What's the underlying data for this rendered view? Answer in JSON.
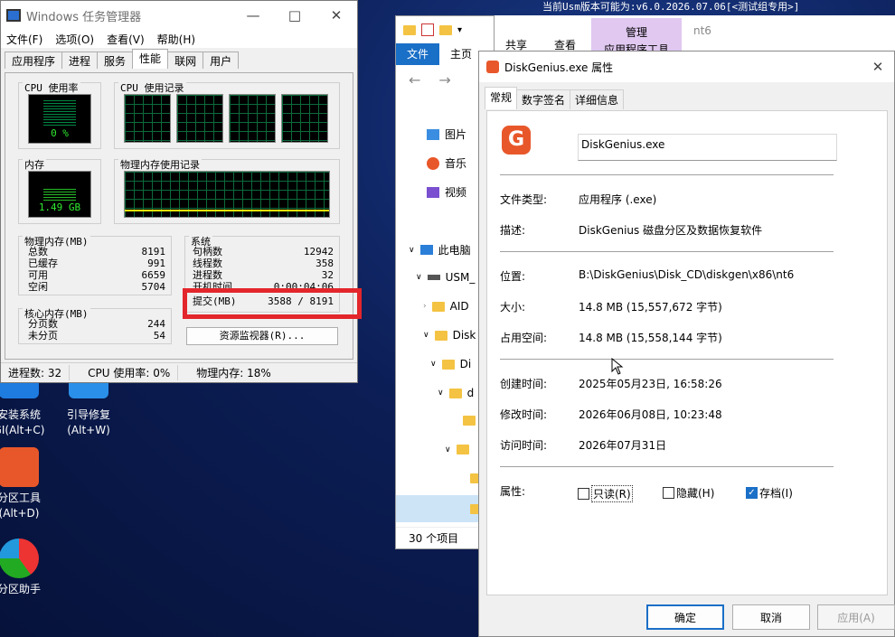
{
  "banner": "当前Usm版本可能为:v6.0.2026.07.06[<测试组专用>]",
  "desktop_icons": [
    {
      "label1": "安装系统",
      "label2": "GI(Alt+C)"
    },
    {
      "label1": "引导修复",
      "label2": "(Alt+W)"
    },
    {
      "label1": "分区工具",
      "label2": "(Alt+D)"
    },
    {
      "label1": "分区助手",
      "label2": ""
    }
  ],
  "taskmgr": {
    "title": "Windows 任务管理器",
    "menu": [
      "文件(F)",
      "选项(O)",
      "查看(V)",
      "帮助(H)"
    ],
    "tabs": [
      "应用程序",
      "进程",
      "服务",
      "性能",
      "联网",
      "用户"
    ],
    "cpu_usage_label": "CPU 使用率",
    "cpu_usage_value": "0 %",
    "cpu_history_label": "CPU 使用记录",
    "mem_label": "内存",
    "mem_value": "1.49 GB",
    "mem_history_label": "物理内存使用记录",
    "physmem": {
      "caption": "物理内存(MB)",
      "rows": [
        [
          "总数",
          "8191"
        ],
        [
          "已缓存",
          "991"
        ],
        [
          "可用",
          "6659"
        ],
        [
          "空闲",
          "5704"
        ]
      ]
    },
    "kernel": {
      "caption": "核心内存(MB)",
      "rows": [
        [
          "分页数",
          "244"
        ],
        [
          "未分页",
          "54"
        ]
      ]
    },
    "system": {
      "caption": "系统",
      "rows": [
        [
          "句柄数",
          "12942"
        ],
        [
          "线程数",
          "358"
        ],
        [
          "进程数",
          "32"
        ],
        [
          "开机时间",
          "0:00:04:06"
        ]
      ],
      "commit_label": "提交(MB)",
      "commit_value": "3588 / 8191"
    },
    "resmon_button": "资源监视器(R)...",
    "status": [
      "进程数: 32",
      "CPU 使用率: 0%",
      "物理内存: 18%"
    ]
  },
  "explorer": {
    "ribbon": [
      "文件",
      "主页"
    ],
    "nav_items": [
      "图片",
      "音乐",
      "视频"
    ],
    "tree": [
      "此电脑",
      "USM_",
      "AID",
      "Disk",
      "Di",
      "d"
    ],
    "status": "30 个项目",
    "extra_tabs": [
      "共享",
      "查看"
    ],
    "manage_tab": "管理",
    "app_tools_tab": "应用程序工具",
    "path_tail": "nt6"
  },
  "props": {
    "title": "DiskGenius.exe 属性",
    "tabs": [
      "常规",
      "数字签名",
      "详细信息"
    ],
    "logo_letter": "G",
    "filename": "DiskGenius.exe",
    "rows": {
      "type_label": "文件类型:",
      "type_value": "应用程序 (.exe)",
      "desc_label": "描述:",
      "desc_value": "DiskGenius 磁盘分区及数据恢复软件",
      "loc_label": "位置:",
      "loc_value": "B:\\DiskGenius\\Disk_CD\\diskgen\\x86\\nt6",
      "size_label": "大小:",
      "size_value": "14.8 MB (15,557,672 字节)",
      "disk_label": "占用空间:",
      "disk_value": "14.8 MB (15,558,144 字节)",
      "created_label": "创建时间:",
      "created_value": "2025年05月23日, 16:58:26",
      "modified_label": "修改时间:",
      "modified_value": "2026年06月08日, 10:23:48",
      "accessed_label": "访问时间:",
      "accessed_value": "2026年07月31日",
      "attr_label": "属性:"
    },
    "attrs": [
      {
        "label": "只读(R)",
        "checked": false
      },
      {
        "label": "隐藏(H)",
        "checked": false
      },
      {
        "label": "存档(I)",
        "checked": true
      }
    ],
    "buttons": {
      "ok": "确定",
      "cancel": "取消",
      "apply": "应用(A)"
    }
  }
}
